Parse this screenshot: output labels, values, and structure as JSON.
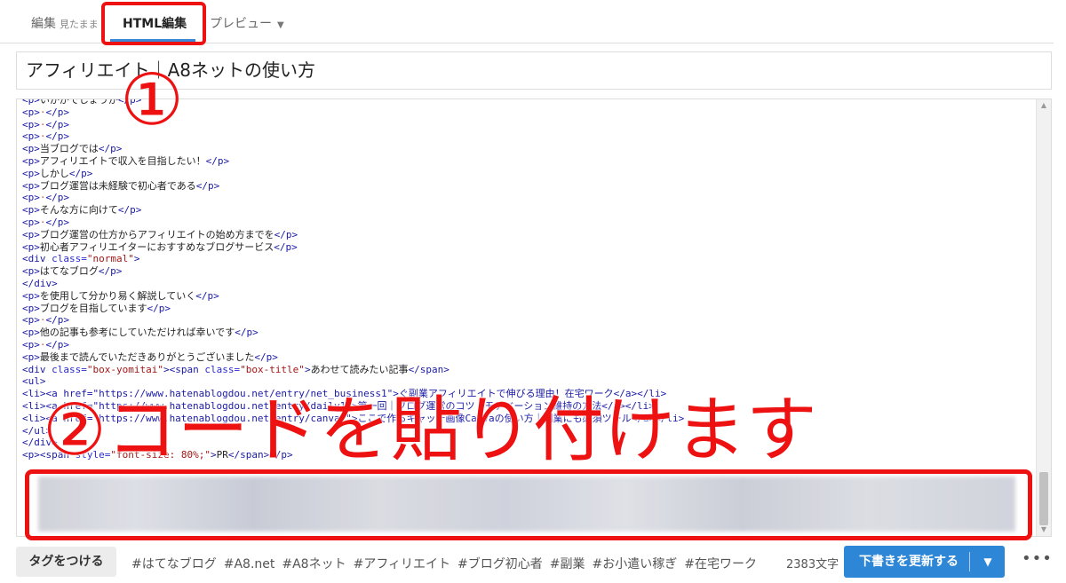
{
  "tabs": {
    "edit_label": "編集",
    "edit_sub": "見たまま",
    "html_label": "HTML編集",
    "preview_label": "プレビュー"
  },
  "title": "アフィリエイト｜A8ネットの使い方",
  "code_lines": [
    {
      "kind": "p",
      "text": "いかがでしょうか"
    },
    {
      "kind": "empty"
    },
    {
      "kind": "empty"
    },
    {
      "kind": "empty"
    },
    {
      "kind": "p",
      "text": "当ブログでは"
    },
    {
      "kind": "p",
      "text": "アフィリエイトで収入を目指したい！"
    },
    {
      "kind": "p",
      "text": "しかし"
    },
    {
      "kind": "p",
      "text": "ブログ運営は未経験で初心者である"
    },
    {
      "kind": "empty"
    },
    {
      "kind": "p",
      "text": "そんな方に向けて"
    },
    {
      "kind": "empty"
    },
    {
      "kind": "p",
      "text": "ブログ運営の仕方からアフィリエイトの始め方までを"
    },
    {
      "kind": "p",
      "text": "初心者アフィリエイターにおすすめなブログサービス"
    },
    {
      "kind": "divopen",
      "cls": "normal"
    },
    {
      "kind": "p",
      "text": "はてなブログ"
    },
    {
      "kind": "divclose"
    },
    {
      "kind": "p",
      "text": "を使用して分かり易く解説していく"
    },
    {
      "kind": "p",
      "text": "ブログを目指しています"
    },
    {
      "kind": "empty"
    },
    {
      "kind": "p",
      "text": "他の記事も参考にしていただければ幸いです"
    },
    {
      "kind": "empty"
    },
    {
      "kind": "p",
      "text": "最後まで読んでいただきありがとうございました"
    },
    {
      "kind": "spanbox",
      "cls": "box-yomitai",
      "span": "box-title",
      "text": "あわせて読みたい記事"
    },
    {
      "kind": "ulopen"
    },
    {
      "kind": "raw",
      "text": "<li><a href=\"https://www.hatenablogdou.net/entry/net_business1\">ぐ副業アフィリエイトで伸びる理由！在宅ワーク</a></li>"
    },
    {
      "kind": "raw",
      "text": "<li><a href=\"https://www.hatenablogdou.net/entry/daily1\">第一回｜ブログ運営のコツ｜モチベーション維持の方法</a></li>"
    },
    {
      "kind": "raw",
      "text": "<li><a href=\"https://www.hatenablogdou.net/entry/canva1\">ここで作るキャッチ画像Canvaの使い方｜副業にも必須ツール</a></li>"
    },
    {
      "kind": "ulclose"
    },
    {
      "kind": "divclose"
    },
    {
      "kind": "pspan",
      "style": "font-size: 80%;",
      "text": "PR"
    }
  ],
  "annotations": {
    "step1": "①",
    "step2": "②コードを貼り付けます"
  },
  "footer": {
    "tag_button": "タグをつける",
    "tags": [
      "#はてなブログ",
      "#A8.net",
      "#A8ネット",
      "#アフィリエイト",
      "#ブログ初心者",
      "#副業",
      "#お小遣い稼ぎ",
      "#在宅ワーク"
    ],
    "word_count": "2383文字",
    "save_label": "下書きを更新する",
    "more_label": "•••"
  },
  "colors": {
    "accent": "#2d86d6",
    "annotation_red": "#ee1111"
  }
}
